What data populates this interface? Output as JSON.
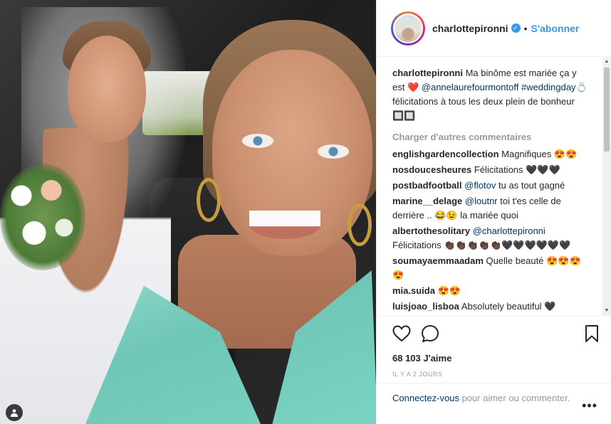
{
  "post": {
    "username": "charlottepironni",
    "follow_label": "S'abonner",
    "separator": "•",
    "verified_mark": "✓"
  },
  "caption": {
    "username": "charlottepironni",
    "text_1": "Ma binôme est mariée ça y est ❤️",
    "mention": "@annelaurefourmontoff",
    "hashtag": "#weddingday💍",
    "text_2": "félicitations à tous les deux plein de bonheur 🔲🔲"
  },
  "load_more_label": "Charger d'autres commentaires",
  "comments": [
    {
      "user": "englishgardencollection",
      "mention": "",
      "text": "Magnifiques 😍😍"
    },
    {
      "user": "nosdoucesheures",
      "mention": "",
      "text": "Félicitations 🖤🖤🖤"
    },
    {
      "user": "postbadfootball",
      "mention": "@flotov",
      "text": "tu as tout gagné"
    },
    {
      "user": "marine__delage",
      "mention": "@loutnr",
      "text": "toi t'es celle de derrière .. 😂😉 la mariée quoi"
    },
    {
      "user": "albertothesolitary",
      "mention": "@charlottepironni",
      "text": "Félicitations 👏🏿👏🏿👏🏿👏🏿👏🏿🖤🖤🖤🖤🖤🖤"
    },
    {
      "user": "soumayaemmaadam",
      "mention": "",
      "text": "Quelle beauté 😍😍😍😍"
    },
    {
      "user": "mia.suida",
      "mention": "",
      "text": "😍😍"
    },
    {
      "user": "luisjoao_lisboa",
      "mention": "",
      "text": "Absolutely beautiful 🖤"
    }
  ],
  "actions": {
    "likes": "68 103 J'aime",
    "time": "IL Y A 2 JOURS"
  },
  "footer": {
    "login_link": "Connectez-vous",
    "login_text": "pour aimer ou commenter.",
    "more": "•••"
  },
  "scroll": {
    "up": "▲",
    "down": "▼"
  },
  "colors": {
    "link": "#003569",
    "accent": "#3897f0",
    "muted": "#999999",
    "dress": "#7ad3c3"
  },
  "icons": [
    "user-tag-icon",
    "verified-badge-icon",
    "heart-icon",
    "comment-icon",
    "bookmark-icon",
    "more-options-icon"
  ]
}
